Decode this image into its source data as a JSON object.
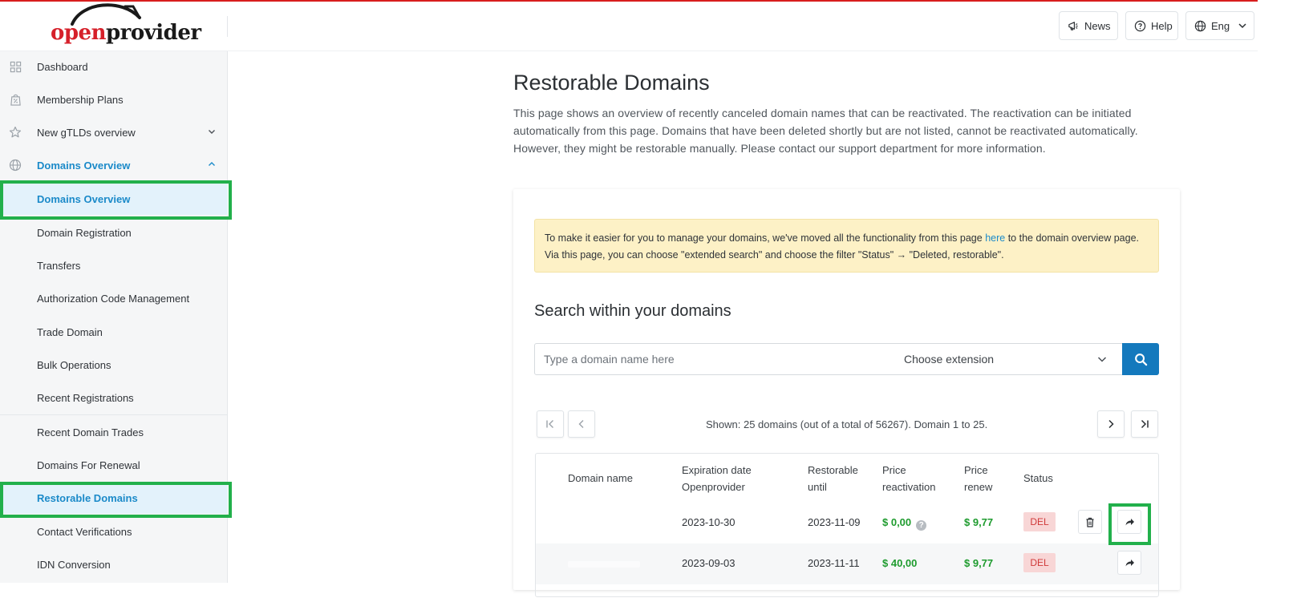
{
  "header": {
    "logo_text_open": "open",
    "logo_text_provider": "provider",
    "news_label": "News",
    "help_label": "Help",
    "lang_label": "Eng"
  },
  "sidebar": {
    "items": [
      {
        "label": "Dashboard",
        "icon": "grid-icon"
      },
      {
        "label": "Membership Plans",
        "icon": "bag-percent-icon"
      },
      {
        "label": "New gTLDs overview",
        "icon": "star-icon",
        "expand": "chevron-down"
      },
      {
        "label": "Domains Overview",
        "icon": "globe-icon",
        "expand": "chevron-up",
        "state": "expanded"
      },
      {
        "label": "Domains Overview",
        "state": "active"
      },
      {
        "label": "Domain Registration"
      },
      {
        "label": "Transfers"
      },
      {
        "label": "Authorization Code Management"
      },
      {
        "label": "Trade Domain"
      },
      {
        "label": "Bulk Operations"
      },
      {
        "label": "Recent Registrations"
      },
      {
        "label": "Recent Domain Trades"
      },
      {
        "label": "Domains For Renewal"
      },
      {
        "label": "Restorable Domains",
        "state": "active"
      },
      {
        "label": "Contact Verifications"
      },
      {
        "label": "IDN Conversion"
      }
    ]
  },
  "main": {
    "title": "Restorable Domains",
    "description": "This page shows an overview of recently canceled domain names that can be reactivated. The reactivation can be initiated automatically from this page. Domains that have been deleted shortly but are not listed, cannot be reactivated automatically. However, they might be restorable manually. Please contact our support department for more information.",
    "notice": {
      "text_before": "To make it easier for you to manage your domains, we've moved all the functionality from this page ",
      "link": "here",
      "text_after": " to the domain overview page. Via this page, you can choose \"extended search\" and choose the filter \"Status\" → \"Deleted, restorable\"."
    },
    "search": {
      "title": "Search within your domains",
      "placeholder": "Type a domain name here",
      "extension_label": "Choose extension"
    },
    "pagination": {
      "info": "Shown: 25 domains (out of a total of 56267). Domain 1 to 25."
    },
    "table": {
      "headers": {
        "domain": "Domain name",
        "expiration": "Expiration date Openprovider",
        "restorable": "Restorable until",
        "price_reactivation": "Price reactivation",
        "price_renew": "Price renew",
        "status": "Status"
      },
      "rows": [
        {
          "domain": "",
          "expiration": "2023-10-30",
          "restorable": "2023-11-09",
          "price_reactivation": "$ 0,00",
          "price_renew": "$ 9,77",
          "status": "DEL"
        },
        {
          "domain": "",
          "expiration": "2023-09-03",
          "restorable": "2023-11-11",
          "price_reactivation": "$ 40,00",
          "price_renew": "$ 9,77",
          "status": "DEL"
        }
      ]
    }
  },
  "colors": {
    "brand_red": "#d6202a",
    "link_blue": "#1b8ac9",
    "search_button": "#1479bd",
    "price_green": "#1e9b2e",
    "status_red": "#d03a3a",
    "highlight_green": "#22b04b",
    "notice_bg": "#fdf1c6"
  }
}
